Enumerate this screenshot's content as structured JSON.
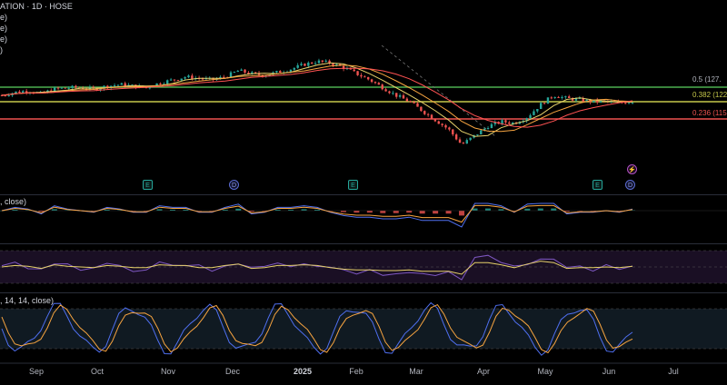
{
  "header": {
    "title_fragment": "ATION · 1D · HOSE",
    "legend_lines": [
      "e)",
      "e)",
      "e)",
      ")"
    ]
  },
  "panes": {
    "macd_title": ", close)",
    "stoch_title": ", 14, 14, close)"
  },
  "fib_levels": [
    {
      "label": "0.5 (127.",
      "color": "#b2b5be"
    },
    {
      "label": "0.382 (122.",
      "color": "#c6c84a"
    },
    {
      "label": "0.236 (115.",
      "color": "#ef5350"
    }
  ],
  "events": [
    {
      "type": "E",
      "name": "earnings-event-icon"
    },
    {
      "type": "D",
      "name": "dividend-event-icon"
    },
    {
      "type": "E",
      "name": "earnings-event-icon"
    },
    {
      "type": "E",
      "name": "earnings-event-icon"
    },
    {
      "type": "D",
      "name": "dividend-event-icon"
    },
    {
      "type": "⚡",
      "name": "split-event-icon"
    }
  ],
  "x_labels": [
    "Sep",
    "Oct",
    "Nov",
    "Dec",
    "2025",
    "Feb",
    "Mar",
    "Apr",
    "May",
    "Jun",
    "Jul"
  ],
  "colors": {
    "up": "#26a69a",
    "down": "#ef5350",
    "fib_green": "#4caf50",
    "fib_yellow": "#c6c84a",
    "fib_red": "#ef5350",
    "ma_orange": "#f7a440",
    "ma_red": "#ff5252",
    "ma_yellow": "#e6d16a",
    "line_blue": "#4f6ff0"
  },
  "chart_data": {
    "type": "line",
    "series": [
      {
        "values": [
          50,
          52,
          53,
          51,
          54,
          55,
          55,
          54,
          56,
          57,
          56,
          55,
          58,
          60,
          62,
          61,
          60,
          62,
          66,
          64,
          63,
          65,
          67,
          70,
          72,
          71,
          68,
          64,
          60,
          55,
          50,
          46,
          40,
          34,
          28,
          18,
          24,
          30,
          33,
          32,
          36,
          44,
          50,
          48,
          47,
          46,
          46,
          45,
          46
        ]
      }
    ]
  }
}
